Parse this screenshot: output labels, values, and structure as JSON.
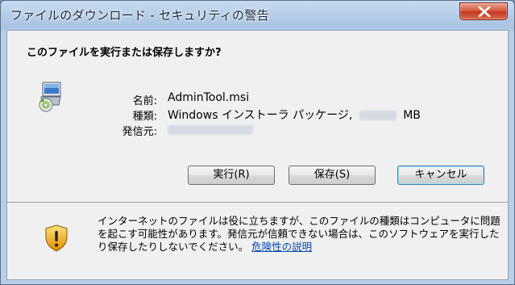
{
  "window": {
    "title": "ファイルのダウンロード - セキュリティの警告",
    "close_icon": "close-x-icon"
  },
  "dialog": {
    "question": "このファイルを実行または保存しますか?",
    "app_icon": "installer-package-icon",
    "fields": {
      "name_label": "名前:",
      "name_value": "AdminTool.msi",
      "type_label": "種類:",
      "type_value_prefix": "Windows インストーラ パッケージ,",
      "type_value_unit": "MB",
      "from_label": "発信元:"
    },
    "buttons": {
      "run": "実行(R)",
      "save": "保存(S)",
      "cancel": "キャンセル"
    },
    "warning": {
      "icon": "shield-warning-icon",
      "text": "インターネットのファイルは役に立ちますが、このファイルの種類はコンピュータに問題を起こす可能性があります。発信元が信頼できない場合は、このソフトウェアを実行したり保存したりしないでください。",
      "link": "危険性の説明"
    },
    "colors": {
      "link": "#0645ad",
      "close_button": "#c4361d"
    }
  }
}
